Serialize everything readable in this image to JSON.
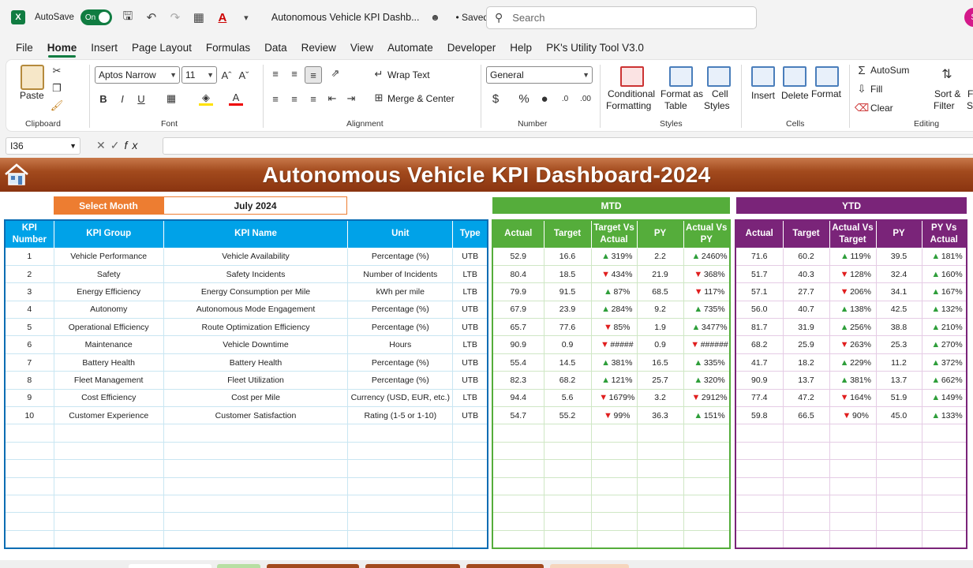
{
  "titlebar": {
    "autosave_label": "AutoSave",
    "autosave_state": "On",
    "doc_title": "Autonomous Vehicle KPI Dashb...",
    "saved": "• Saved",
    "search_placeholder": "Search",
    "avatar_initial": "S"
  },
  "menu": [
    "File",
    "Home",
    "Insert",
    "Page Layout",
    "Formulas",
    "Data",
    "Review",
    "View",
    "Automate",
    "Developer",
    "Help",
    "PK's Utility Tool V3.0"
  ],
  "ribbon": {
    "clipboard": {
      "label": "Clipboard",
      "paste": "Paste"
    },
    "font": {
      "label": "Font",
      "font_name": "Aptos Narrow",
      "font_size": "11"
    },
    "alignment": {
      "label": "Alignment",
      "wrap": "Wrap Text",
      "merge": "Merge & Center"
    },
    "number": {
      "label": "Number",
      "format": "General"
    },
    "styles": {
      "label": "Styles",
      "cond": "Conditional",
      "cond2": "Formatting",
      "fmt_table": "Format as",
      "fmt_table2": "Table",
      "cell_styles": "Cell",
      "cell_styles2": "Styles"
    },
    "cells": {
      "label": "Cells",
      "insert": "Insert",
      "delete": "Delete",
      "format": "Format"
    },
    "editing": {
      "label": "Editing",
      "autosum": "AutoSum",
      "fill": "Fill",
      "clear": "Clear",
      "sort": "Sort &",
      "sort2": "Filter",
      "find": "Fi",
      "find2": "Se"
    }
  },
  "formula_bar": {
    "cell_ref": "I36"
  },
  "dashboard": {
    "title": "Autonomous Vehicle KPI Dashboard-2024",
    "select_month_label": "Select Month",
    "select_month_value": "July 2024",
    "mtd_label": "MTD",
    "ytd_label": "YTD",
    "kpi_headers": [
      "KPI Number",
      "KPI Group",
      "KPI Name",
      "Unit",
      "Type"
    ],
    "mtd_headers": [
      "Actual",
      "Target",
      "Target Vs Actual",
      "PY",
      "Actual Vs PY"
    ],
    "ytd_headers": [
      "Actual",
      "Target",
      "Actual Vs Target",
      "PY",
      "PY Vs Actual"
    ],
    "rows": [
      {
        "num": "1",
        "group": "Vehicle Performance",
        "name": "Vehicle Availability",
        "unit": "Percentage (%)",
        "type": "UTB",
        "mtd": [
          "52.9",
          "16.6",
          "up",
          "319%",
          "2.2",
          "up",
          "2460%"
        ],
        "ytd": [
          "71.6",
          "60.2",
          "up",
          "119%",
          "39.5",
          "up",
          "181%"
        ]
      },
      {
        "num": "2",
        "group": "Safety",
        "name": "Safety Incidents",
        "unit": "Number of Incidents",
        "type": "LTB",
        "mtd": [
          "80.4",
          "18.5",
          "down",
          "434%",
          "21.9",
          "down",
          "368%"
        ],
        "ytd": [
          "51.7",
          "40.3",
          "down",
          "128%",
          "32.4",
          "up",
          "160%"
        ]
      },
      {
        "num": "3",
        "group": "Energy Efficiency",
        "name": "Energy Consumption per Mile",
        "unit": "kWh per mile",
        "type": "LTB",
        "mtd": [
          "79.9",
          "91.5",
          "up",
          "87%",
          "68.5",
          "down",
          "117%"
        ],
        "ytd": [
          "57.1",
          "27.7",
          "down",
          "206%",
          "34.1",
          "up",
          "167%"
        ]
      },
      {
        "num": "4",
        "group": "Autonomy",
        "name": "Autonomous Mode Engagement",
        "unit": "Percentage (%)",
        "type": "UTB",
        "mtd": [
          "67.9",
          "23.9",
          "up",
          "284%",
          "9.2",
          "up",
          "735%"
        ],
        "ytd": [
          "56.0",
          "40.7",
          "up",
          "138%",
          "42.5",
          "up",
          "132%"
        ]
      },
      {
        "num": "5",
        "group": "Operational Efficiency",
        "name": "Route Optimization Efficiency",
        "unit": "Percentage (%)",
        "type": "UTB",
        "mtd": [
          "65.7",
          "77.6",
          "down",
          "85%",
          "1.9",
          "up",
          "3477%"
        ],
        "ytd": [
          "81.7",
          "31.9",
          "up",
          "256%",
          "38.8",
          "up",
          "210%"
        ]
      },
      {
        "num": "6",
        "group": "Maintenance",
        "name": "Vehicle Downtime",
        "unit": "Hours",
        "type": "LTB",
        "mtd": [
          "90.9",
          "0.9",
          "down",
          "#####",
          "0.9",
          "down",
          "######"
        ],
        "ytd": [
          "68.2",
          "25.9",
          "down",
          "263%",
          "25.3",
          "up",
          "270%"
        ]
      },
      {
        "num": "7",
        "group": "Battery Health",
        "name": "Battery Health",
        "unit": "Percentage (%)",
        "type": "UTB",
        "mtd": [
          "55.4",
          "14.5",
          "up",
          "381%",
          "16.5",
          "up",
          "335%"
        ],
        "ytd": [
          "41.7",
          "18.2",
          "up",
          "229%",
          "11.2",
          "up",
          "372%"
        ]
      },
      {
        "num": "8",
        "group": "Fleet Management",
        "name": "Fleet Utilization",
        "unit": "Percentage (%)",
        "type": "UTB",
        "mtd": [
          "82.3",
          "68.2",
          "up",
          "121%",
          "25.7",
          "up",
          "320%"
        ],
        "ytd": [
          "90.9",
          "13.7",
          "up",
          "381%",
          "13.7",
          "up",
          "662%"
        ]
      },
      {
        "num": "9",
        "group": "Cost Efficiency",
        "name": "Cost per Mile",
        "unit": "Currency (USD, EUR, etc.)",
        "type": "LTB",
        "mtd": [
          "94.4",
          "5.6",
          "down",
          "1679%",
          "3.2",
          "down",
          "2912%"
        ],
        "ytd": [
          "77.4",
          "47.2",
          "down",
          "164%",
          "51.9",
          "up",
          "149%"
        ]
      },
      {
        "num": "10",
        "group": "Customer Experience",
        "name": "Customer Satisfaction",
        "unit": "Rating (1-5 or 1-10)",
        "type": "UTB",
        "mtd": [
          "54.7",
          "55.2",
          "down",
          "99%",
          "36.3",
          "up",
          "151%"
        ],
        "ytd": [
          "59.8",
          "66.5",
          "down",
          "90%",
          "45.0",
          "up",
          "133%"
        ]
      }
    ]
  },
  "colors": {
    "excel_green": "#107c41",
    "banner": "#a24a1d",
    "kpi_header": "#00a2e8",
    "mtd": "#55ad3b",
    "ytd": "#7a2479",
    "select_month": "#ed7d31",
    "up": "#2e9e3a",
    "down": "#e01e1e"
  }
}
